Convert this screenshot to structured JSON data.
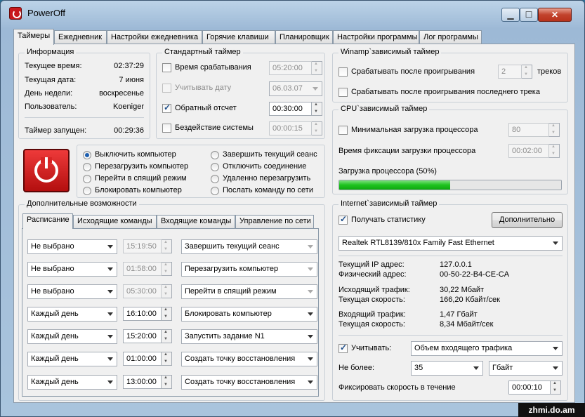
{
  "window": {
    "title": "PowerOff",
    "min": "▁",
    "max": "☐",
    "close": "✕"
  },
  "tabs": [
    "Таймеры",
    "Ежедневник",
    "Настройки ежедневника",
    "Горячие клавиши",
    "Планировщик",
    "Настройки программы",
    "Лог программы"
  ],
  "info": {
    "title": "Информация",
    "rows": [
      {
        "label": "Текущее время:",
        "value": "02:37:29"
      },
      {
        "label": "Текущая дата:",
        "value": "7 июня"
      },
      {
        "label": "День недели:",
        "value": "воскресенье"
      },
      {
        "label": "Пользователь:",
        "value": "Koeniger"
      }
    ],
    "timer_label": "Таймер запущен:",
    "timer_value": "00:29:36"
  },
  "standard": {
    "title": "Стандартный таймер",
    "rows": [
      {
        "label": "Время срабатывания",
        "value": "05:20:00",
        "checked": false,
        "enabled": false
      },
      {
        "label": "Учитывать дату",
        "value": "06.03.07",
        "checked": false,
        "enabled": false
      },
      {
        "label": "Обратный отсчет",
        "value": "00:30:00",
        "checked": true,
        "enabled": true
      },
      {
        "label": "Бездействие системы",
        "value": "00:00:15",
        "checked": false,
        "enabled": false
      }
    ]
  },
  "actions": {
    "left": [
      "Выключить компьютер",
      "Перезагрузить компьютер",
      "Перейти в спящий режим",
      "Блокировать компьютер"
    ],
    "right": [
      "Завершить текущий сеанс",
      "Отключить соединение",
      "Удаленно перезагрузить",
      "Послать команду по сети"
    ],
    "selected": "Выключить компьютер"
  },
  "extra": {
    "title": "Дополнительные возможности",
    "subtabs": [
      "Расписание",
      "Исходящие команды",
      "Входящие команды",
      "Управление по сети"
    ],
    "schedule": [
      {
        "when": "Не выбрано",
        "time": "15:19:50",
        "action": "Завершить текущий сеанс",
        "enabled": false
      },
      {
        "when": "Не выбрано",
        "time": "01:58:00",
        "action": "Перезагрузить компьютер",
        "enabled": false
      },
      {
        "when": "Не выбрано",
        "time": "05:30:00",
        "action": "Перейти в спящий режим",
        "enabled": false
      },
      {
        "when": "Каждый день",
        "time": "16:10:00",
        "action": "Блокировать компьютер",
        "enabled": true
      },
      {
        "when": "Каждый день",
        "time": "15:20:00",
        "action": "Запустить задание N1",
        "enabled": true
      },
      {
        "when": "Каждый день",
        "time": "01:00:00",
        "action": "Создать точку восстановления",
        "enabled": true
      },
      {
        "when": "Каждый день",
        "time": "13:00:00",
        "action": "Создать точку восстановления",
        "enabled": true
      }
    ]
  },
  "winamp": {
    "title": "Winamp`зависимый таймер",
    "after_play": "Срабатывать после проигрывания",
    "count": "2",
    "tracks": "треков",
    "after_last": "Срабатывать после проигрывания последнего трека"
  },
  "cpu": {
    "title": "CPU`зависимый таймер",
    "min_load": "Минимальная загрузка процессора",
    "min_value": "80",
    "fix_time": "Время фиксации загрузки процессора",
    "fix_value": "00:02:00",
    "load_label": "Загрузка процессора (50%)",
    "load_fraction": 0.5,
    "bar_color": "#1ec31e"
  },
  "internet": {
    "title": "Internet`зависимый таймер",
    "get_stats": "Получать статистику",
    "more_btn": "Дополнительно",
    "adapter": "Realtek RTL8139/810x Family Fast Ethernet",
    "stats": [
      [
        {
          "label": "Текущий IP адрес:",
          "value": "127.0.0.1"
        },
        {
          "label": "Физический адрес:",
          "value": "00-50-22-B4-CE-CA"
        }
      ],
      [
        {
          "label": "Исходящий трафик:",
          "value": "30,22 Мбайт"
        },
        {
          "label": "Текущая скорость:",
          "value": "166,20 Кбайт/сек"
        }
      ],
      [
        {
          "label": "Входящий трафик:",
          "value": "1,47 Гбайт"
        },
        {
          "label": "Текущая скорость:",
          "value": "8,34 Мбайт/сек"
        }
      ]
    ],
    "consider": "Учитывать:",
    "consider_value": "Объем входящего трафика",
    "no_more": "Не более:",
    "limit": "35",
    "unit": "Гбайт",
    "fix_speed": "Фиксировать скорость в течение",
    "fix_speed_value": "00:00:10"
  },
  "watermark": "zhmi.do.am"
}
